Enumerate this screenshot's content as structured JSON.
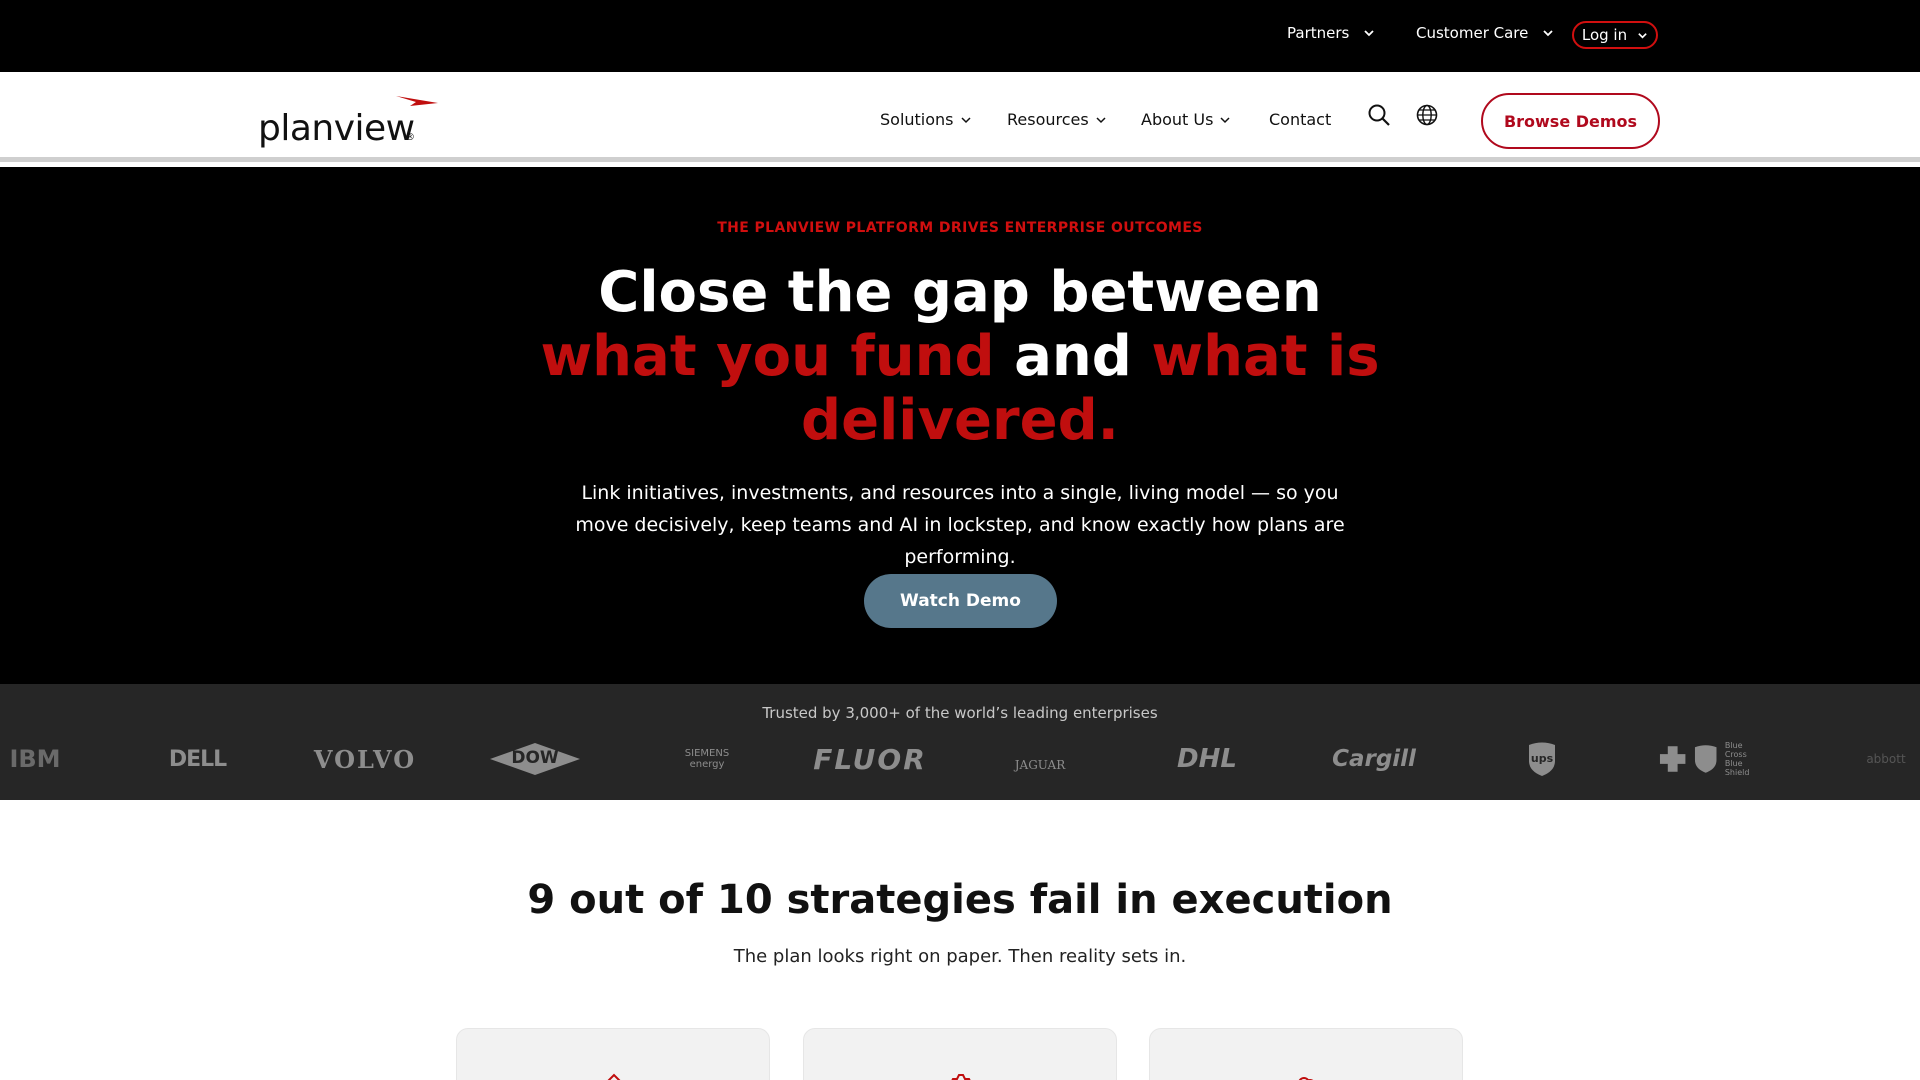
{
  "utility_bar": {
    "partners": "Partners",
    "customer_care": "Customer Care",
    "login": "Log in"
  },
  "header": {
    "logo_text": "planview",
    "logo_mark": "®",
    "nav": {
      "solutions": "Solutions",
      "resources": "Resources",
      "about": "About Us",
      "contact": "Contact"
    },
    "icons": [
      "search-icon",
      "globe-icon"
    ],
    "browse_demos": "Browse Demos"
  },
  "hero": {
    "eyebrow": "THE PLANVIEW PLATFORM DRIVES ENTERPRISE OUTCOMES",
    "headline_line1": "Close the gap between",
    "headline_red1": "what you fund",
    "headline_and": " and ",
    "headline_red2": "what is delivered.",
    "description": "Link initiatives, investments, and resources into a single, living model — so you move decisively, keep teams and AI in lockstep, and know exactly how plans are performing.",
    "cta": "Watch Demo"
  },
  "trusted": {
    "text": "Trusted by 3,000+ of the world’s leading enterprises",
    "logos": [
      "IBM",
      "DELL",
      "VOLVO",
      "DOW",
      "SIEMENS energy",
      "FLUOR",
      "JAGUAR",
      "DHL",
      "Cargill",
      "ups",
      "Blue Cross Blue Shield",
      "abbott"
    ]
  },
  "section": {
    "title": "9 out of 10 strategies fail in execution",
    "subtitle": "The plan looks right on paper. Then reality sets in."
  },
  "colors": {
    "accent_red": "#c00e0e",
    "button_blue_gray": "#56778b",
    "strip_bg": "#262626"
  }
}
